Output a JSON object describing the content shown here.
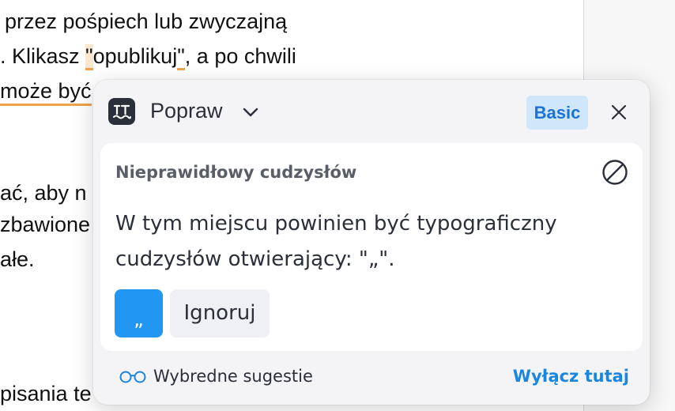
{
  "document": {
    "line1": "przez pośpiech lub zwyczajną",
    "line2_pre": ". Klikasz ",
    "line2_mark": "\"",
    "line2_word": "opublikuj",
    "line2_close": "\"",
    "line2_post": ", a po chwili",
    "line3": "może być",
    "line4": "ać, aby n",
    "line5": "zbawione",
    "line6": "ałe.",
    "line7": "pisania te"
  },
  "popup": {
    "mode_label": "Popraw",
    "plan_badge": "Basic",
    "card_title": "Nieprawidłowy cudzysłów",
    "message_line1": "W tym miejscu powinien być typograficzny",
    "message_line2": "cudzysłów otwierający: \"„\".",
    "suggestion": "„",
    "ignore_label": "Ignoruj",
    "footer_label": "Wybredne sugestie",
    "footer_link": "Wyłącz tutaj"
  },
  "colors": {
    "accent": "#2196f3",
    "badge_bg": "#cfe6fb",
    "badge_text": "#1a73d9",
    "underline": "#f0a24a"
  },
  "icons": [
    "languagetool-logo-icon",
    "chevron-down-icon",
    "close-icon",
    "disable-icon",
    "glasses-icon"
  ]
}
